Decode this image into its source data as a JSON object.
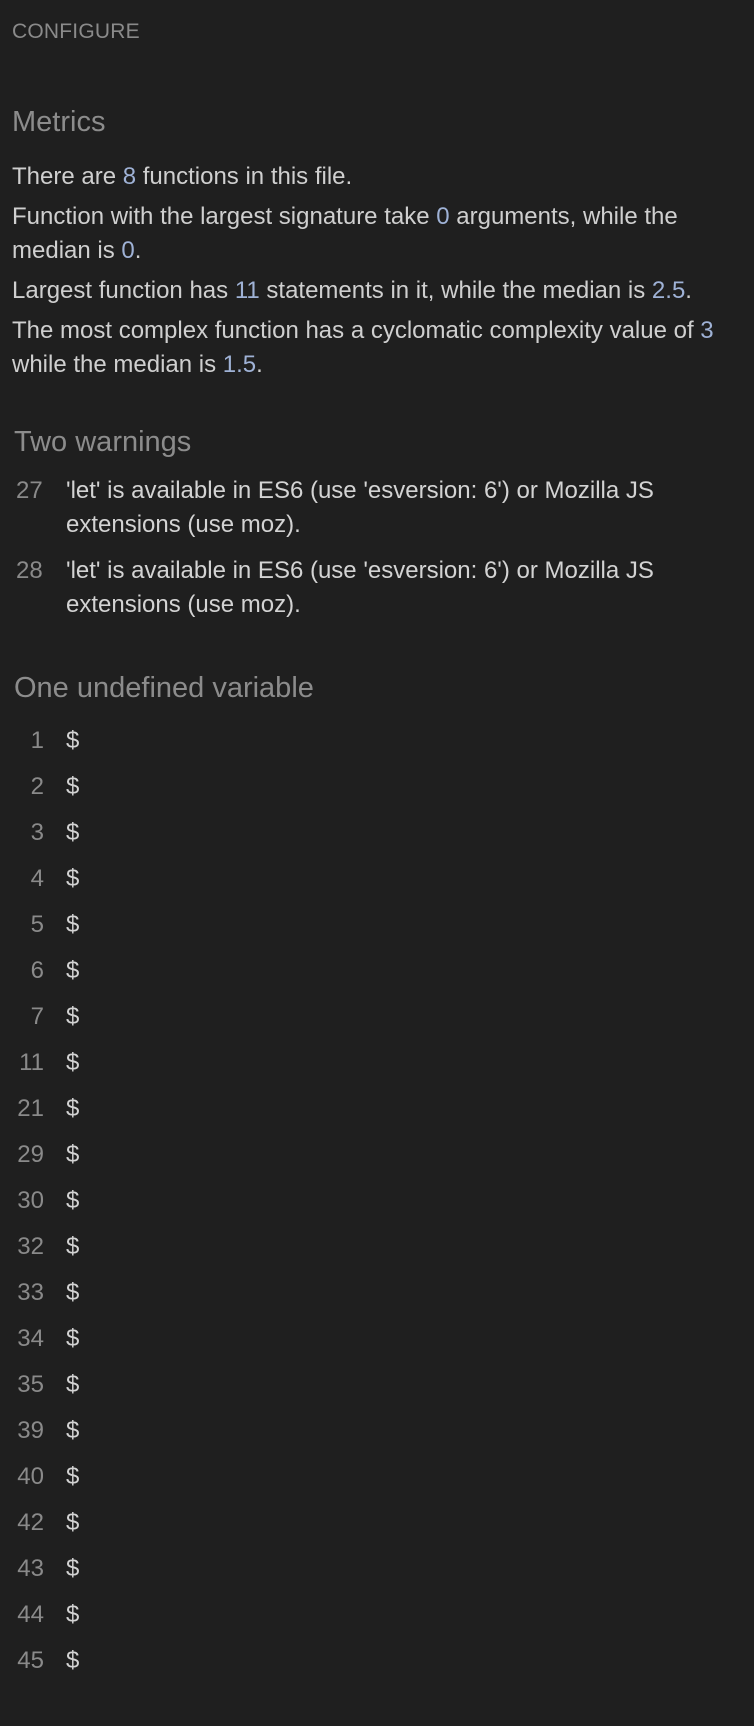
{
  "header": {
    "configure_label": "CONFIGURE"
  },
  "metrics": {
    "title": "Metrics",
    "functions_count": "8",
    "largest_signature_args": "0",
    "median_signature_args": "0",
    "largest_function_statements": "11",
    "median_statements": "2.5",
    "max_cyclomatic": "3",
    "median_cyclomatic": "1.5",
    "text": {
      "l1_a": "There are ",
      "l1_b": " functions in this file.",
      "l2_a": "Function with the largest signature take ",
      "l2_b": " arguments, while the median is ",
      "l2_c": ".",
      "l3_a": "Largest function has ",
      "l3_b": " statements in it, while the median is ",
      "l3_c": ".",
      "l4_a": "The most complex function has a cyclomatic complexity value of ",
      "l4_b": " while the median is ",
      "l4_c": "."
    }
  },
  "warnings": {
    "title": "Two warnings",
    "items": [
      {
        "line": "27",
        "message": "'let' is available in ES6 (use 'esversion: 6') or Mozilla JS extensions (use moz)."
      },
      {
        "line": "28",
        "message": "'let' is available in ES6 (use 'esversion: 6') or Mozilla JS extensions (use moz)."
      }
    ]
  },
  "undefined_vars": {
    "title": "One undefined variable",
    "items": [
      {
        "line": "1",
        "name": "$"
      },
      {
        "line": "2",
        "name": "$"
      },
      {
        "line": "3",
        "name": "$"
      },
      {
        "line": "4",
        "name": "$"
      },
      {
        "line": "5",
        "name": "$"
      },
      {
        "line": "6",
        "name": "$"
      },
      {
        "line": "7",
        "name": "$"
      },
      {
        "line": "11",
        "name": "$"
      },
      {
        "line": "21",
        "name": "$"
      },
      {
        "line": "29",
        "name": "$"
      },
      {
        "line": "30",
        "name": "$"
      },
      {
        "line": "32",
        "name": "$"
      },
      {
        "line": "33",
        "name": "$"
      },
      {
        "line": "34",
        "name": "$"
      },
      {
        "line": "35",
        "name": "$"
      },
      {
        "line": "39",
        "name": "$"
      },
      {
        "line": "40",
        "name": "$"
      },
      {
        "line": "42",
        "name": "$"
      },
      {
        "line": "43",
        "name": "$"
      },
      {
        "line": "44",
        "name": "$"
      },
      {
        "line": "45",
        "name": "$"
      }
    ]
  }
}
